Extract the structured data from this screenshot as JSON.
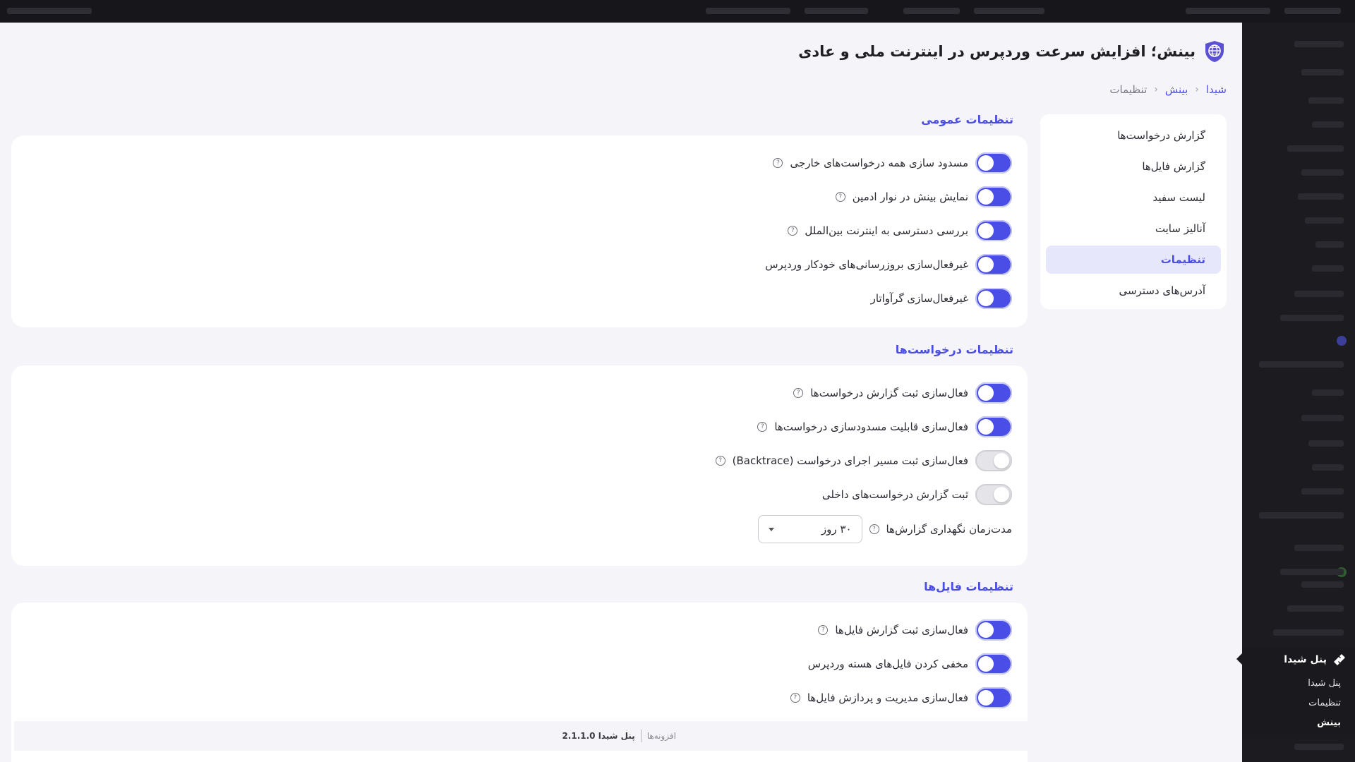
{
  "page": {
    "title": "بینش؛ افزایش سرعت وردپرس در اینترنت ملی و عادی",
    "breadcrumb": [
      "شیدا",
      "بینش",
      "تنظیمات"
    ]
  },
  "sidebar": {
    "items": [
      {
        "label": "گزارش درخواست‌ها"
      },
      {
        "label": "گزارش فایل‌ها"
      },
      {
        "label": "لیست سفید"
      },
      {
        "label": "آنالیز سایت"
      },
      {
        "label": "تنظیمات",
        "active": true
      },
      {
        "label": "آدرس‌های دسترسی"
      }
    ]
  },
  "sections": {
    "general": {
      "title": "تنظیمات عمومی",
      "options": [
        {
          "label": "مسدود سازی همه درخواست‌های خارجی",
          "enabled": true,
          "help": true
        },
        {
          "label": "نمایش بینش در نوار ادمین",
          "enabled": true,
          "help": true
        },
        {
          "label": "بررسی دسترسی به اینترنت بین‌الملل",
          "enabled": true,
          "help": true
        },
        {
          "label": "غیرفعال‌سازی بروزرسانی‌های خودکار وردپرس",
          "enabled": true,
          "help": false
        },
        {
          "label": "غیرفعال‌سازی گرآواتار",
          "enabled": true,
          "help": false
        }
      ]
    },
    "requests": {
      "title": "تنظیمات درخواست‌ها",
      "options": [
        {
          "label": "فعال‌سازی ثبت گزارش درخواست‌ها",
          "enabled": true,
          "help": true
        },
        {
          "label": "فعال‌سازی قابلیت مسدودسازی درخواست‌ها",
          "enabled": true,
          "help": true
        },
        {
          "label": "فعال‌سازی ثبت مسیر اجرای درخواست (Backtrace)",
          "enabled": false,
          "help": true
        },
        {
          "label": "ثبت گزارش درخواست‌های داخلی",
          "enabled": false,
          "help": false
        }
      ],
      "retention": {
        "label": "مدت‌زمان نگهداری گزارش‌ها",
        "value": "۳۰ روز"
      }
    },
    "files": {
      "title": "تنظیمات فایل‌ها",
      "options": [
        {
          "label": "فعال‌سازی ثبت گزارش فایل‌ها",
          "enabled": true,
          "help": true
        },
        {
          "label": "مخفی کردن فایل‌های هسته وردپرس",
          "enabled": true,
          "help": false
        },
        {
          "label": "فعال‌سازی مدیریت و پردازش فایل‌ها",
          "enabled": true,
          "help": true
        }
      ]
    }
  },
  "footer": {
    "plugins_label": "افزونه‌ها",
    "version_label": "پنل شیدا 2.1.1.0"
  },
  "flyout": {
    "title": "پنل شیدا",
    "items": [
      {
        "label": "پنل شیدا"
      },
      {
        "label": "تنظیمات"
      },
      {
        "label": "بینش",
        "current": true
      }
    ]
  },
  "colors": {
    "accent": "#4b4ee6",
    "active_bg": "#e7e7fb",
    "page_bg": "#f5f5f9",
    "admin_bg": "#1c1c20"
  }
}
